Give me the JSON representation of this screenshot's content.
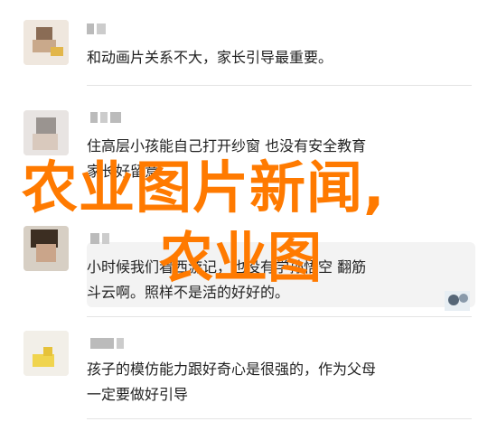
{
  "comments": [
    {
      "text": "和动画片关系不大，家长引导最重要。"
    },
    {
      "text_line1": "住高层小孩能自己打开纱窗 也没有安全教育",
      "text_line2": "家长好留意"
    },
    {
      "text_line1": "小时候我们看西游记，也没有学孙悟空  翻筋",
      "text_line2": "斗云啊。照样不是活的好好的。"
    },
    {
      "text_line1": "孩子的模仿能力跟好奇心是很强的，作为父母",
      "text_line2": "一定要做好引导"
    }
  ],
  "overlay": {
    "title_big": "农业图片新闻,",
    "title_small": "农业图"
  },
  "colors": {
    "accent": "#ff7a00",
    "text": "#222222",
    "divider": "#e4e4e4"
  }
}
